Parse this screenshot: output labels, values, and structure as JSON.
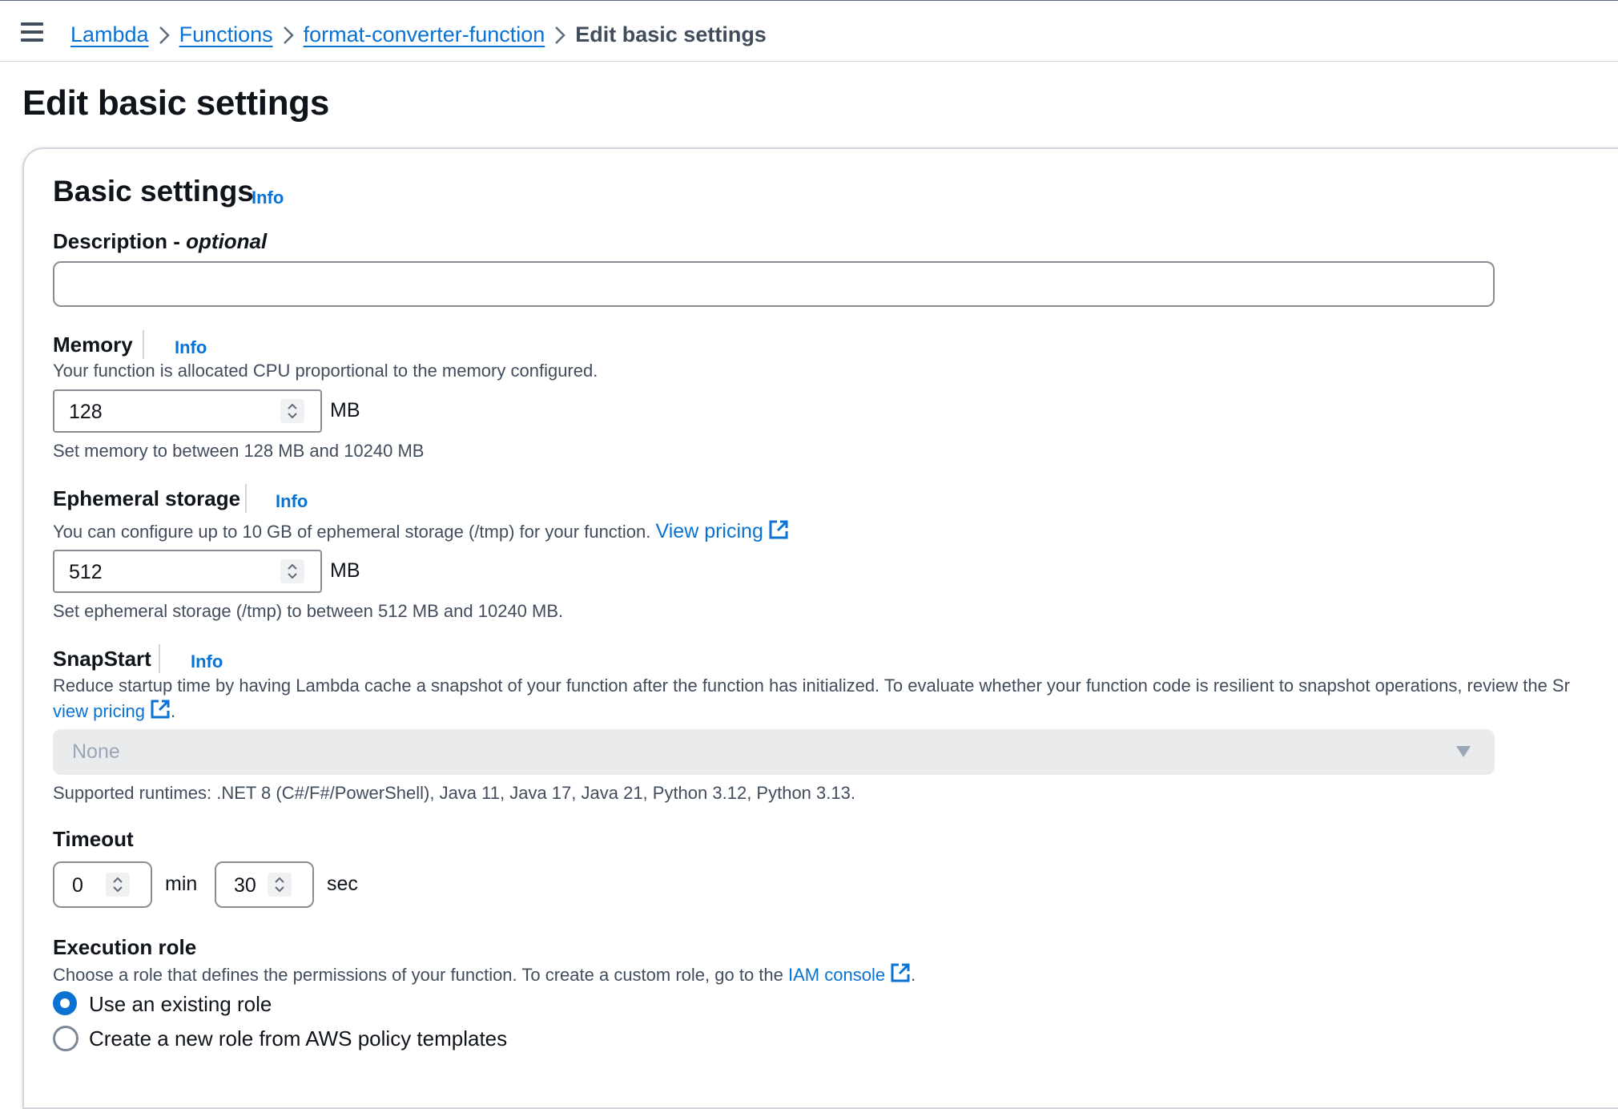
{
  "breadcrumb": {
    "items": [
      "Lambda",
      "Functions",
      "format-converter-function"
    ],
    "current": "Edit basic settings"
  },
  "page": {
    "title": "Edit basic settings"
  },
  "basic_settings": {
    "title": "Basic settings",
    "info": "Info",
    "description": {
      "label": "Description - ",
      "label_optional": "optional",
      "value": ""
    },
    "memory": {
      "label": "Memory",
      "info": "Info",
      "help": "Your function is allocated CPU proportional to the memory configured.",
      "value": "128",
      "unit": "MB",
      "constraint": "Set memory to between 128 MB and 10240 MB"
    },
    "ephemeral_storage": {
      "label": "Ephemeral storage",
      "info": "Info",
      "help": "You can configure up to 10 GB of ephemeral storage (/tmp) for your function.",
      "pricing_link": "View pricing",
      "value": "512",
      "unit": "MB",
      "constraint": "Set ephemeral storage (/tmp) to between 512 MB and 10240 MB."
    },
    "snapstart": {
      "label": "SnapStart",
      "info": "Info",
      "help": "Reduce startup time by having Lambda cache a snapshot of your function after the function has initialized. To evaluate whether your function code is resilient to snapshot operations, review the Sr",
      "pricing_link": "view pricing",
      "trailing": ".",
      "selected": "None",
      "supported": "Supported runtimes: .NET 8 (C#/F#/PowerShell), Java 11, Java 17, Java 21, Python 3.12, Python 3.13."
    },
    "timeout": {
      "label": "Timeout",
      "min_value": "0",
      "min_unit": "min",
      "sec_value": "30",
      "sec_unit": "sec"
    },
    "execution_role": {
      "label": "Execution role",
      "help": "Choose a role that defines the permissions of your function. To create a custom role, go to the",
      "iam_link": "IAM console",
      "trailing": ".",
      "options": [
        "Use an existing role",
        "Create a new role from AWS policy templates"
      ],
      "selected_index": 0
    }
  },
  "colors": {
    "link": "#0972d3",
    "text": "#0f141a",
    "muted": "#414d5c",
    "border": "#8c8c94"
  }
}
